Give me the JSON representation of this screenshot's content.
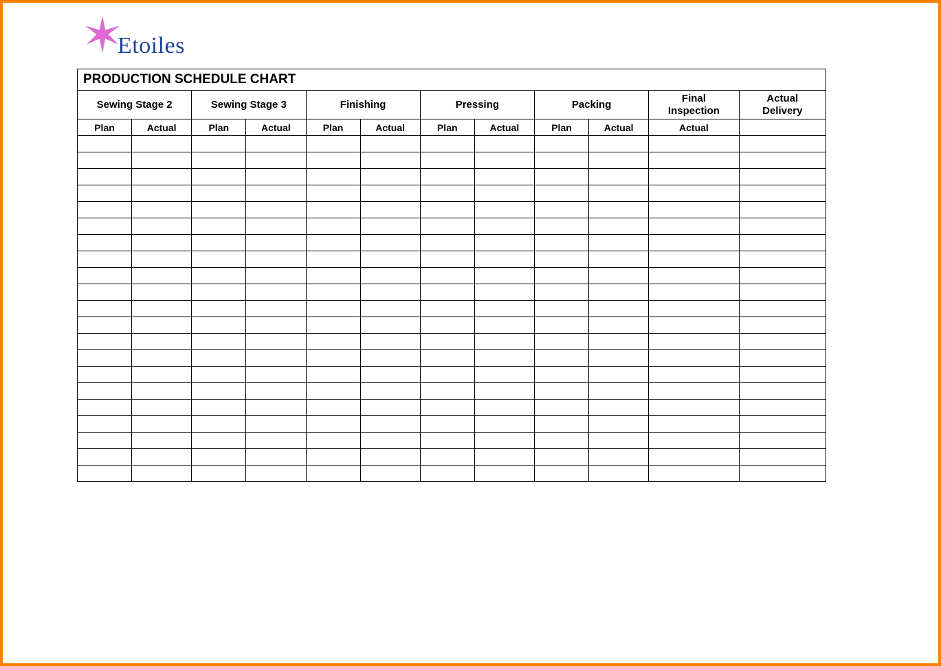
{
  "logo": {
    "text": "Etoiles"
  },
  "table": {
    "title": "PRODUCTION SCHEDULE CHART",
    "categories": [
      {
        "label": "Sewing Stage 2",
        "span": 2
      },
      {
        "label": "Sewing Stage 3",
        "span": 2
      },
      {
        "label": "Finishing",
        "span": 2
      },
      {
        "label": "Pressing",
        "span": 2
      },
      {
        "label": "Packing",
        "span": 2
      },
      {
        "label": "Final\nInspection",
        "span": 1
      },
      {
        "label": "Actual\nDelivery",
        "span": 1
      }
    ],
    "subheaders": [
      "Plan",
      "Actual",
      "Plan",
      "Actual",
      "Plan",
      "Actual",
      "Plan",
      "Actual",
      "Plan",
      "Actual",
      "Actual",
      ""
    ],
    "row_count": 21,
    "col_count": 12
  }
}
